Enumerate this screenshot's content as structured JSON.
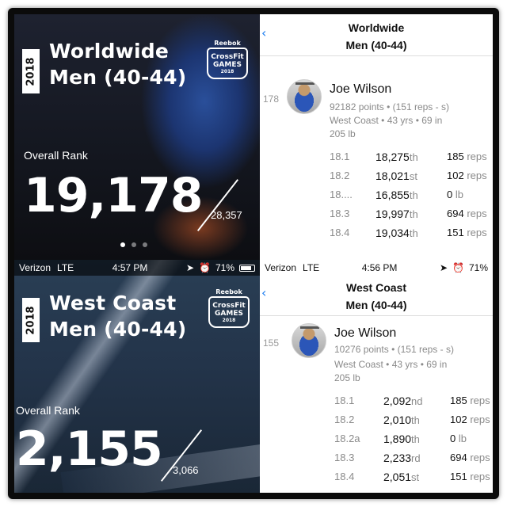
{
  "colors": {
    "accent_blue": "#1a7cf0",
    "muted_text": "#8a8a8a",
    "battery_green": "#4cd964"
  },
  "panel_top_left": {
    "year": "2018",
    "title_line1": "Worldwide",
    "title_line2": "Men (40-44)",
    "logo": {
      "brand": "Reebok",
      "line1": "CrossFit",
      "line2": "GAMES",
      "year": "2018"
    },
    "overall_rank_label": "Overall Rank",
    "overall_rank": "19,178",
    "total_athletes": "28,357",
    "page_dots": {
      "count": 3,
      "active": 0
    }
  },
  "panel_top_right": {
    "header_line1": "Worldwide",
    "header_line2": "Men (40-44)",
    "athlete": {
      "rank": "178",
      "name": "Joe Wilson",
      "points": "92182 points",
      "points_detail": "(151 reps - s)",
      "region": "West Coast",
      "age": "43 yrs",
      "height": "69 in",
      "weight": "205 lb"
    },
    "events": [
      {
        "name": "18.1",
        "rank": "18,275",
        "suffix": "th",
        "score": "185",
        "unit": "reps"
      },
      {
        "name": "18.2",
        "rank": "18,021",
        "suffix": "st",
        "score": "102",
        "unit": "reps"
      },
      {
        "name": "18....",
        "rank": "16,855",
        "suffix": "th",
        "score": "0",
        "unit": "lb"
      },
      {
        "name": "18.3",
        "rank": "19,997",
        "suffix": "th",
        "score": "694",
        "unit": "reps"
      },
      {
        "name": "18.4",
        "rank": "19,034",
        "suffix": "th",
        "score": "151",
        "unit": "reps"
      }
    ]
  },
  "panel_bottom_left": {
    "status": {
      "carrier": "Verizon",
      "network": "LTE",
      "time": "4:57 PM",
      "battery": "71%"
    },
    "year": "2018",
    "title_line1": "West Coast",
    "title_line2": "Men (40-44)",
    "logo": {
      "brand": "Reebok",
      "line1": "CrossFit",
      "line2": "GAMES",
      "year": "2018"
    },
    "overall_rank_label": "Overall Rank",
    "overall_rank": "2,155",
    "total_athletes": "3,066"
  },
  "panel_bottom_right": {
    "status": {
      "carrier": "Verizon",
      "network": "LTE",
      "time": "4:56 PM",
      "battery": "71%"
    },
    "header_line1": "West Coast",
    "header_line2": "Men (40-44)",
    "athlete": {
      "rank": "155",
      "name": "Joe Wilson",
      "points": "10276 points",
      "points_detail": "(151 reps - s)",
      "region": "West Coast",
      "age": "43 yrs",
      "height": "69 in",
      "weight": "205 lb"
    },
    "events": [
      {
        "name": "18.1",
        "rank": "2,092",
        "suffix": "nd",
        "score": "185",
        "unit": "reps"
      },
      {
        "name": "18.2",
        "rank": "2,010",
        "suffix": "th",
        "score": "102",
        "unit": "reps"
      },
      {
        "name": "18.2a",
        "rank": "1,890",
        "suffix": "th",
        "score": "0",
        "unit": "lb"
      },
      {
        "name": "18.3",
        "rank": "2,233",
        "suffix": "rd",
        "score": "694",
        "unit": "reps"
      },
      {
        "name": "18.4",
        "rank": "2,051",
        "suffix": "st",
        "score": "151",
        "unit": "reps"
      }
    ]
  }
}
